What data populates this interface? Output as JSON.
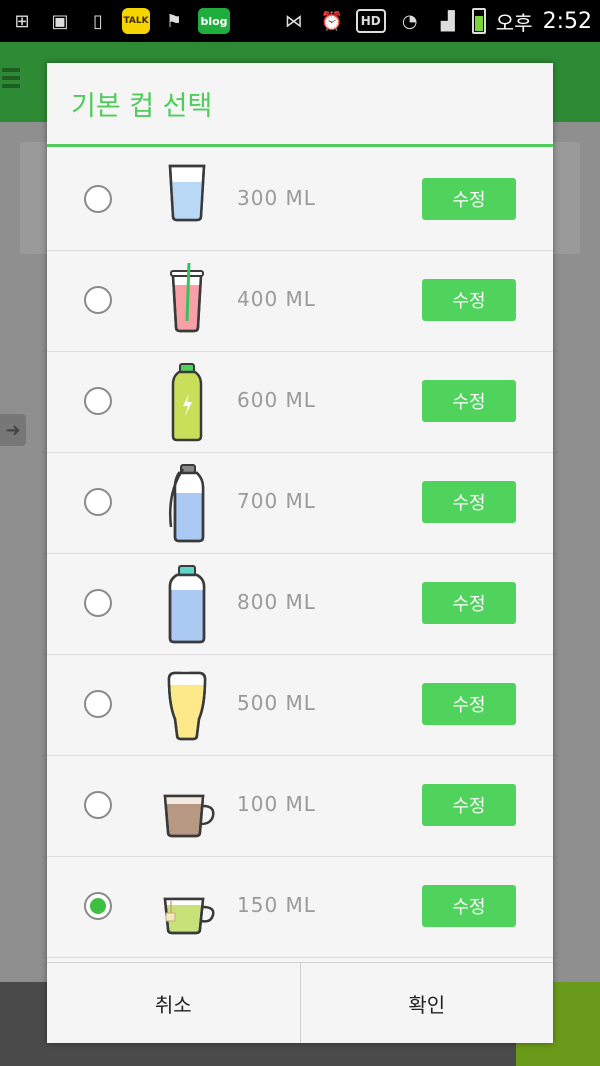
{
  "status_bar": {
    "kakao_label": "TALK",
    "blog_label": "blog",
    "hd_label": "HD",
    "ampm": "오후",
    "time": "2:52"
  },
  "dialog": {
    "title": "기본 컵 선택",
    "cups": [
      {
        "label": "300 ML",
        "edit": "수정",
        "icon": "glass-icon",
        "selected": false
      },
      {
        "label": "400 ML",
        "edit": "수정",
        "icon": "straw-cup-icon",
        "selected": false
      },
      {
        "label": "600 ML",
        "edit": "수정",
        "icon": "energy-bottle-icon",
        "selected": false
      },
      {
        "label": "700 ML",
        "edit": "수정",
        "icon": "strap-bottle-icon",
        "selected": false
      },
      {
        "label": "800 ML",
        "edit": "수정",
        "icon": "water-bottle-icon",
        "selected": false
      },
      {
        "label": "500 ML",
        "edit": "수정",
        "icon": "beer-glass-icon",
        "selected": false
      },
      {
        "label": "100 ML",
        "edit": "수정",
        "icon": "coffee-cup-icon",
        "selected": false
      },
      {
        "label": "150 ML",
        "edit": "수정",
        "icon": "tea-cup-icon",
        "selected": true
      }
    ],
    "cancel": "취소",
    "confirm": "확인"
  },
  "colors": {
    "accent": "#4fd35c",
    "title": "#4fcc5a"
  }
}
